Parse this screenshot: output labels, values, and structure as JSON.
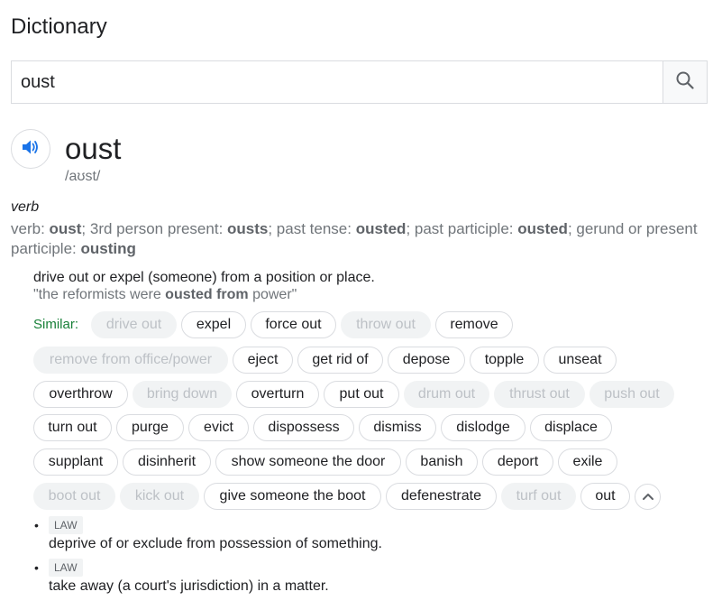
{
  "header": {
    "title": "Dictionary"
  },
  "search": {
    "value": "oust"
  },
  "entry": {
    "word": "oust",
    "phonetic": "/aʊst/",
    "pos": "verb",
    "forms": [
      {
        "label": "verb: ",
        "value": "oust"
      },
      {
        "label": "; 3rd person present: ",
        "value": "ousts"
      },
      {
        "label": "; past tense: ",
        "value": "ousted"
      },
      {
        "label": "; past participle: ",
        "value": "ousted"
      },
      {
        "label": "; gerund or present participle: ",
        "value": "ousting"
      }
    ],
    "definition": "drive out or expel (someone) from a position or place.",
    "example": {
      "before": "\"the reformists were ",
      "bold": "ousted from",
      "after": " power\""
    },
    "similar_label": "Similar:",
    "similar": [
      {
        "text": "drive out",
        "muted": true
      },
      {
        "text": "expel",
        "muted": false
      },
      {
        "text": "force out",
        "muted": false
      },
      {
        "text": "throw out",
        "muted": true
      },
      {
        "text": "remove",
        "muted": false
      },
      {
        "text": "remove from office/power",
        "muted": true
      },
      {
        "text": "eject",
        "muted": false
      },
      {
        "text": "get rid of",
        "muted": false
      },
      {
        "text": "depose",
        "muted": false
      },
      {
        "text": "topple",
        "muted": false
      },
      {
        "text": "unseat",
        "muted": false
      },
      {
        "text": "overthrow",
        "muted": false
      },
      {
        "text": "bring down",
        "muted": true
      },
      {
        "text": "overturn",
        "muted": false
      },
      {
        "text": "put out",
        "muted": false
      },
      {
        "text": "drum out",
        "muted": true
      },
      {
        "text": "thrust out",
        "muted": true
      },
      {
        "text": "push out",
        "muted": true
      },
      {
        "text": "turn out",
        "muted": false
      },
      {
        "text": "purge",
        "muted": false
      },
      {
        "text": "evict",
        "muted": false
      },
      {
        "text": "dispossess",
        "muted": false
      },
      {
        "text": "dismiss",
        "muted": false
      },
      {
        "text": "dislodge",
        "muted": false
      },
      {
        "text": "displace",
        "muted": false
      },
      {
        "text": "supplant",
        "muted": false
      },
      {
        "text": "disinherit",
        "muted": false
      },
      {
        "text": "show someone the door",
        "muted": false
      },
      {
        "text": "banish",
        "muted": false
      },
      {
        "text": "deport",
        "muted": false
      },
      {
        "text": "exile",
        "muted": false
      },
      {
        "text": "boot out",
        "muted": true
      },
      {
        "text": "kick out",
        "muted": true
      },
      {
        "text": "give someone the boot",
        "muted": false
      },
      {
        "text": "defenestrate",
        "muted": false
      },
      {
        "text": "turf out",
        "muted": true
      },
      {
        "text": "out",
        "muted": false
      }
    ],
    "subsenses": [
      {
        "bullet": "•",
        "badge": "LAW",
        "text": "deprive of or exclude from possession of something."
      },
      {
        "bullet": "•",
        "badge": "LAW",
        "text": "take away (a court's jurisdiction) in a matter."
      }
    ]
  },
  "icons": {
    "search": "search-icon",
    "speaker": "speaker-icon",
    "collapse": "chevron-up-icon"
  },
  "colors": {
    "accent_blue": "#1a73e8",
    "similar_green": "#188038",
    "muted_chip_bg": "#f1f3f4",
    "muted_chip_text": "#bdc1c6"
  }
}
